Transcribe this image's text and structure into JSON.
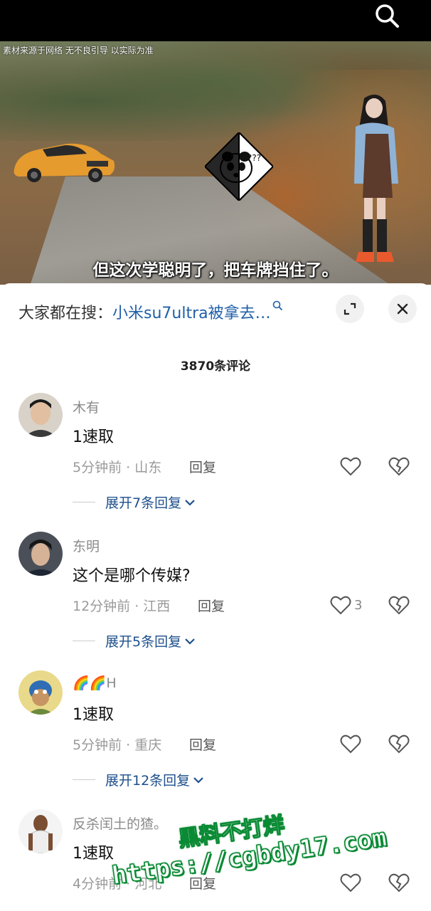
{
  "video": {
    "source_notice": "素材来源于网络 无不良引导 以实际为准",
    "subtitle": "但这次学聪明了，把车牌挡住了。",
    "sticker_text": "???"
  },
  "sheet": {
    "search_prefix": "大家都在搜：",
    "search_query": "小米su7ultra被拿去…",
    "comment_count": "3870条评论"
  },
  "comments": [
    {
      "username": "木有",
      "text": "1速取",
      "time_location": "5分钟前 · 山东",
      "reply_label": "回复",
      "likes": "",
      "expand_label": "展开7条回复"
    },
    {
      "username": "东明",
      "text": "这个是哪个传媒?",
      "time_location": "12分钟前 · 江西",
      "reply_label": "回复",
      "likes": "3",
      "expand_label": "展开5条回复"
    },
    {
      "username": "🌈🌈H",
      "text": "1速取",
      "time_location": "5分钟前 · 重庆",
      "reply_label": "回复",
      "likes": "",
      "expand_label": "展开12条回复"
    },
    {
      "username": "反杀闰土的猹。",
      "text": "1速取",
      "time_location": "4分钟前 · 河北",
      "reply_label": "回复",
      "likes": "",
      "expand_label": ""
    }
  ],
  "overlay_watermark": {
    "line1": "黑料不打烊",
    "line2": "https://cgbdy17.com"
  },
  "colors": {
    "link_blue": "#1f5fa8",
    "expand_blue": "#1d4f8c",
    "meta_gray": "#9a9a9a",
    "promo_green": "#0a8a34"
  }
}
